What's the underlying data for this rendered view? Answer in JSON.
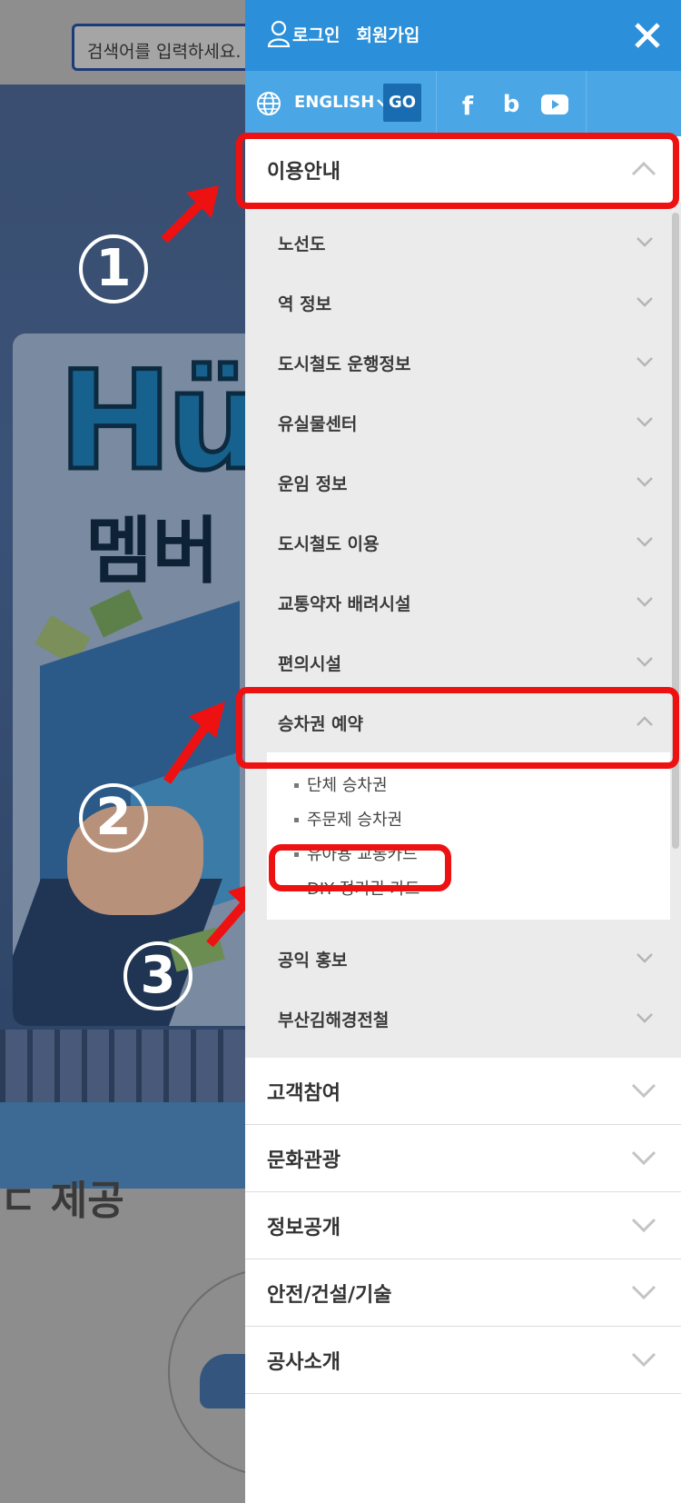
{
  "background": {
    "search_placeholder": "검색어를 입력하세요.",
    "content_heading": "ㄷ 제공"
  },
  "header": {
    "login": "로그인",
    "signup": "회원가입",
    "lang": "ENGLISH",
    "go": "GO"
  },
  "menu": {
    "sections": [
      {
        "label": "이용안내",
        "expanded": true
      },
      {
        "label": "고객참여"
      },
      {
        "label": "문화관광"
      },
      {
        "label": "정보공개"
      },
      {
        "label": "안전/건설/기술"
      },
      {
        "label": "공사소개"
      }
    ],
    "sub": [
      "노선도",
      "역 정보",
      "도시철도 운행정보",
      "유실물센터",
      "운임 정보",
      "도시철도 이용",
      "교통약자 배려시설",
      "편의시설",
      "승차권 예약",
      "공익 홍보",
      "부산김해경전철"
    ],
    "leaves": [
      "단체 승차권",
      "주문제 승차권",
      "유아용 교통카드",
      "DIY 정기권 카드"
    ]
  },
  "annotations": {
    "step1": "1",
    "step2": "2",
    "step3": "3",
    "highlight_color": "#ee1111"
  }
}
